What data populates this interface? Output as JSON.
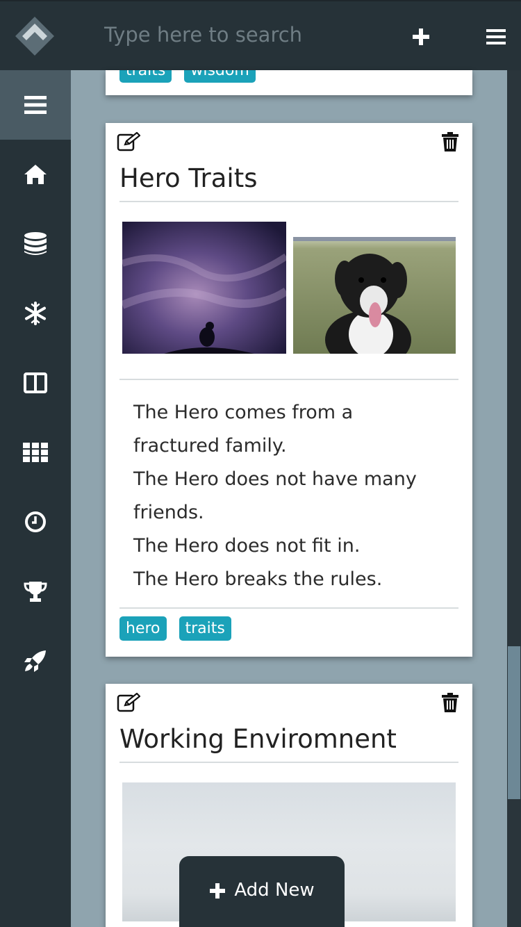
{
  "search": {
    "placeholder": "Type here to search"
  },
  "sidebar": {
    "items": [
      {
        "icon": "menu-icon",
        "active": true
      },
      {
        "icon": "home-icon"
      },
      {
        "icon": "database-icon"
      },
      {
        "icon": "snowflake-icon"
      },
      {
        "icon": "columns-icon"
      },
      {
        "icon": "grid-icon"
      },
      {
        "icon": "clock-icon"
      },
      {
        "icon": "trophy-icon"
      },
      {
        "icon": "rocket-icon"
      }
    ]
  },
  "cards": [
    {
      "partial": true,
      "tags": [
        "traits",
        "wisdom"
      ]
    },
    {
      "title": "Hero Traits",
      "images": [
        "sky-silhouette-image",
        "dog-in-field-image"
      ],
      "lines": [
        "The Hero comes from a",
        "fractured family.",
        "The Hero does not have many",
        "friends.",
        "The Hero does not fit in.",
        "The Hero breaks the rules."
      ],
      "tags": [
        "hero",
        "traits"
      ]
    },
    {
      "title": "Working Enviromnent",
      "images": [
        "workspace-image"
      ]
    }
  ],
  "add_new": {
    "label": "Add New"
  },
  "colors": {
    "chrome": "#263238",
    "background": "#8fa4ae",
    "tag": "#1ba2b9",
    "active_sidebar": "#4a5b64"
  }
}
